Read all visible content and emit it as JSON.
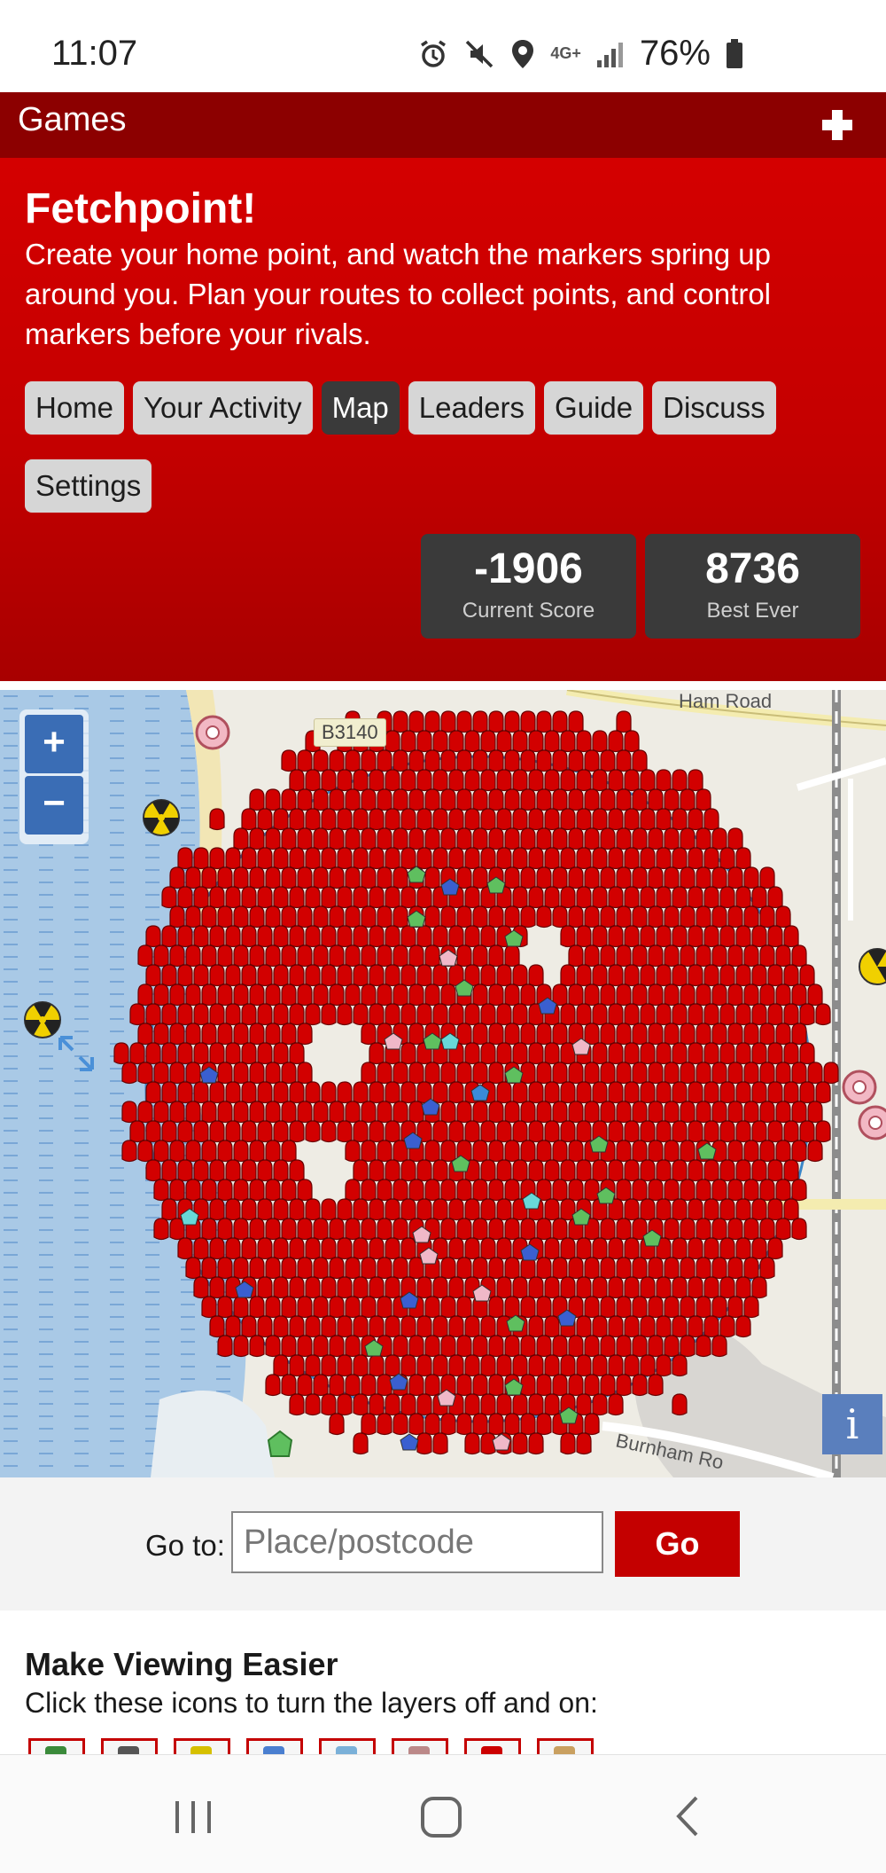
{
  "status_bar": {
    "time": "11:07",
    "network": "4G+",
    "battery": "76%"
  },
  "header": {
    "title": "Games",
    "plus_icon": "plus-icon"
  },
  "hero": {
    "title": "Fetchpoint!",
    "description": "Create your home point, and watch the markers spring up around you. Plan your routes to collect points, and control markers before your rivals."
  },
  "nav": {
    "items": [
      {
        "label": "Home",
        "active": false
      },
      {
        "label": "Your Activity",
        "active": false
      },
      {
        "label": "Map",
        "active": true
      },
      {
        "label": "Leaders",
        "active": false
      },
      {
        "label": "Guide",
        "active": false
      },
      {
        "label": "Discuss",
        "active": false
      },
      {
        "label": "Settings",
        "active": false
      }
    ]
  },
  "scores": {
    "current": {
      "value": "-1906",
      "label": "Current Score"
    },
    "best": {
      "value": "8736",
      "label": "Best Ever"
    }
  },
  "map": {
    "zoom_in": "+",
    "zoom_out": "−",
    "info": "i",
    "road_labels": {
      "ham_road": "Ham Road",
      "b_road": "B3140",
      "burnham_road": "Burnham Ro"
    },
    "marker_color": "#d20000"
  },
  "goto": {
    "label": "Go to:",
    "placeholder": "Place/postcode",
    "value": "",
    "button": "Go"
  },
  "layers": {
    "title": "Make Viewing Easier",
    "description": "Click these icons to turn the layers off and on:",
    "icon_colors": [
      "#3a8a3a",
      "#555555",
      "#d6c000",
      "#4a7fd0",
      "#7ab0d8",
      "#bb8888",
      "#cc0000",
      "#c9a060"
    ]
  },
  "colors": {
    "brand_red": "#c40000",
    "dark_red": "#8c0000",
    "dark_gray": "#3a3a3a"
  }
}
